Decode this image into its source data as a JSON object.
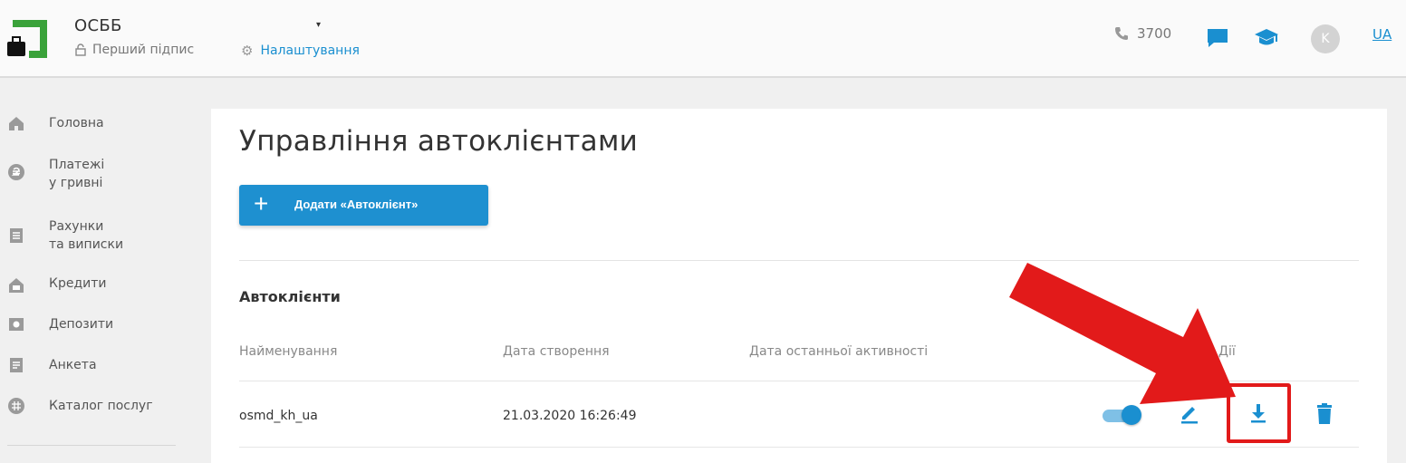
{
  "header": {
    "org_name": "ОСББ",
    "caret": "▾",
    "signer": "Перший підпис",
    "settings": "Налаштування",
    "phone": "3700",
    "avatar_letter": "K",
    "language": "UA",
    "icons": [
      "briefcase-logo-icon",
      "lock-icon",
      "gear-icon",
      "phone-icon",
      "chat-icon",
      "graduation-cap-icon"
    ],
    "accent_color": "#1a8fd0"
  },
  "sidebar": {
    "items": [
      {
        "label": "Головна",
        "label2": "",
        "icon": "home-icon"
      },
      {
        "label": "Платежі",
        "label2": "у гривні",
        "icon": "hryvnia-icon"
      },
      {
        "label": "Рахунки",
        "label2": "та виписки",
        "icon": "statement-icon"
      },
      {
        "label": "Кредити",
        "label2": "",
        "icon": "credit-house-icon"
      },
      {
        "label": "Депозити",
        "label2": "",
        "icon": "deposit-icon"
      },
      {
        "label": "Анкета",
        "label2": "",
        "icon": "form-icon"
      },
      {
        "label": "Каталог послуг",
        "label2": "",
        "icon": "catalog-icon"
      }
    ]
  },
  "main": {
    "title": "Управління автоклієнтами",
    "add_button": {
      "icon": "+",
      "label": "Додати «Автоклієнт»"
    },
    "section_title": "Автоклієнти",
    "columns": [
      "Найменування",
      "Дата створення",
      "Дата останньої активності",
      "Дії"
    ],
    "rows": [
      {
        "name": "osmd_kh_ua",
        "created": "21.03.2020 16:26:49",
        "last_activity": "",
        "active": true,
        "actions": [
          "toggle",
          "edit-icon",
          "download-icon",
          "trash-icon"
        ]
      }
    ]
  },
  "annotation": {
    "color": "#e21a1a",
    "target": "download-icon"
  }
}
